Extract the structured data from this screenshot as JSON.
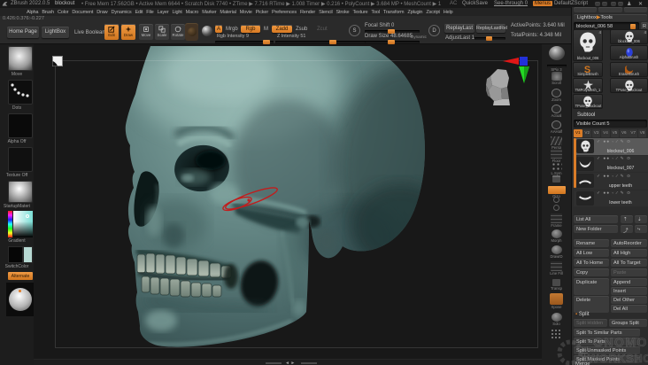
{
  "titlebar": {
    "title": "ZBrush 2022.0.5",
    "document": "blockout",
    "stats": "• Free Mem 17.562GB • Active Mem 6644 • Scratch Disk 7740 •  ZTime ▶ 7.716 RTime ▶ 1.008 Timer ▶ 0.216 • PolyCount ▶ 3.684 MP • MeshCount ▶ 1",
    "ac": "AC",
    "quicksave": "QuickSave",
    "see_through": "See-through 0",
    "menus": "Menus",
    "zscript": "DefaultZScript",
    "close": "✕"
  },
  "menubar": [
    "Alpha",
    "Brush",
    "Color",
    "Document",
    "Draw",
    "Dynamics",
    "Edit",
    "File",
    "Layer",
    "Light",
    "Macro",
    "Marker",
    "Material",
    "Movie",
    "Picker",
    "Preferences",
    "Render",
    "Stencil",
    "Stroke",
    "Texture",
    "Tool",
    "Transform",
    "Zplugin",
    "Zscript",
    "Help"
  ],
  "toolbar": {
    "coords": "0.426:0.376:-0.227",
    "home_page": "Home Page",
    "lightbox": "LightBox",
    "live_boolean": "Live Boolean",
    "edit": "Edit",
    "draw": "Draw",
    "move": "Move",
    "scale": "Scale",
    "rotate": "Rotate",
    "a_toggle": "A",
    "mrgb": "Mrgb",
    "rgb": "Rgb",
    "m": "M",
    "zadd": "Zadd",
    "zsub": "Zsub",
    "zcut": "Zcut",
    "rgb_intensity": "Rgb Intensity 9",
    "z_intensity": "Z Intensity 51",
    "s_badge": "S",
    "d_badge": "D",
    "focal_shift": "Focal Shift 0",
    "draw_size": "Draw Size 48.64685",
    "dynamic": "Dynamic",
    "replay_last": "ReplayLast",
    "replay_last_rel": "ReplayLastRel",
    "adjust_last": "AdjustLast 1",
    "active_points": "ActivePoints: 3.640 Mil",
    "total_points": "TotalPoints: 4.348 Mil"
  },
  "left_tray": {
    "brush_label": "Move",
    "stroke_label": "Dots",
    "alpha_label": "Alpha Off",
    "texture_label": "Texture Off",
    "material_label": "StartupMateri",
    "gradient_label": "Gradient",
    "switchcolor_label": "SwitchColor",
    "alternate_label": "Alternate"
  },
  "right_shelf": [
    {
      "label": "",
      "icon": "sphere"
    },
    {
      "label": "SPix 3",
      "icon": "slider"
    },
    {
      "label": "Scroll",
      "icon": "hand"
    },
    {
      "label": "Zoom",
      "icon": "magnifier"
    },
    {
      "label": "Actual",
      "icon": "magnifier"
    },
    {
      "label": "AAHalf",
      "icon": "magnifier"
    },
    {
      "label": "Persp",
      "icon": "lines"
    },
    {
      "label": "Floor",
      "icon": "grid"
    },
    {
      "label": "L.Sym",
      "icon": "dots"
    },
    {
      "label": "",
      "icon": "lock"
    },
    {
      "label": "Gizo",
      "icon": "orange"
    },
    {
      "label": "",
      "icon": "gear"
    },
    {
      "label": "",
      "icon": "circle"
    },
    {
      "label": "Frame",
      "icon": "frame"
    },
    {
      "label": "Morph",
      "icon": "sphere-pen"
    },
    {
      "label": "DrawID",
      "icon": "sphere-pen"
    },
    {
      "label": "Line Fill",
      "icon": "grid"
    },
    {
      "label": "Transp",
      "icon": "small"
    },
    {
      "label": "Xpose",
      "icon": "orange-tile"
    },
    {
      "label": "Solo",
      "icon": "sphere-sm"
    },
    {
      "label": "",
      "icon": "dotted"
    }
  ],
  "tool_panel": {
    "header_left": "Lightbox",
    "header_arrow": "▶",
    "header_right": "Tools",
    "tool_slider": "blockout_006  58",
    "r_button": "R",
    "current_tool": {
      "name": "blockout_006",
      "badge": "4"
    },
    "recent_tools": [
      {
        "name": "blockout_006",
        "badge": "4",
        "icon": "skull"
      },
      {
        "name": "AlphaBrush",
        "icon": "blob"
      },
      {
        "name": "SimpleBrush",
        "icon": "s"
      },
      {
        "name": "EraserBrush",
        "icon": "crescent"
      },
      {
        "name": "TMPolyMesh_1",
        "icon": "star"
      },
      {
        "name": "TPose_blockout",
        "icon": "skull"
      },
      {
        "name": "TPose_blockout",
        "icon": "skull"
      }
    ],
    "subtool": {
      "header": "Subtool",
      "visible_count": "Visible Count 5",
      "tabs": [
        "V1",
        "V2",
        "V3",
        "V4",
        "V5",
        "V6",
        "V7",
        "V8"
      ],
      "active_tab": "V1",
      "items": [
        {
          "name": "blockout_006",
          "thumb": "skull",
          "selected": true
        },
        {
          "name": "blockout_007",
          "thumb": "jaw",
          "selected": false
        },
        {
          "name": "upper teeth",
          "thumb": "upper-teeth",
          "selected": false
        },
        {
          "name": "lower teeth",
          "thumb": "lower-teeth",
          "selected": false
        }
      ]
    },
    "buttons": {
      "list_all": "List All",
      "new_folder": "New Folder",
      "pairs": [
        [
          "Rename",
          "AutoReorder"
        ],
        [
          "All Low",
          "All High"
        ],
        [
          "All To Home",
          "All To Target"
        ],
        [
          "Copy",
          "Paste"
        ]
      ],
      "duplicate": "Duplicate",
      "append": "Append",
      "insert": "Insert",
      "delete": "Delete",
      "del_other": "Del Other",
      "del_all": "Del All",
      "split_header": "Split",
      "split_hidden": "Split Hidden",
      "groups_split": "Groups Split",
      "split_rows": [
        "Split To Similar Parts",
        "Split To Parts",
        "Split Unmasked Points",
        "Split Masked Points"
      ],
      "merge_header": "Merge"
    }
  },
  "canvas": {
    "model_name": "skull sculpt (blockout)",
    "annotation_color": "#c11d1d",
    "skull_base_color": "#567576",
    "skull_highlight_color": "#9cc0ba"
  },
  "watermark": {
    "the": "THE",
    "gnomon": "GNOMON",
    "workshop": "WORKSHOP"
  }
}
